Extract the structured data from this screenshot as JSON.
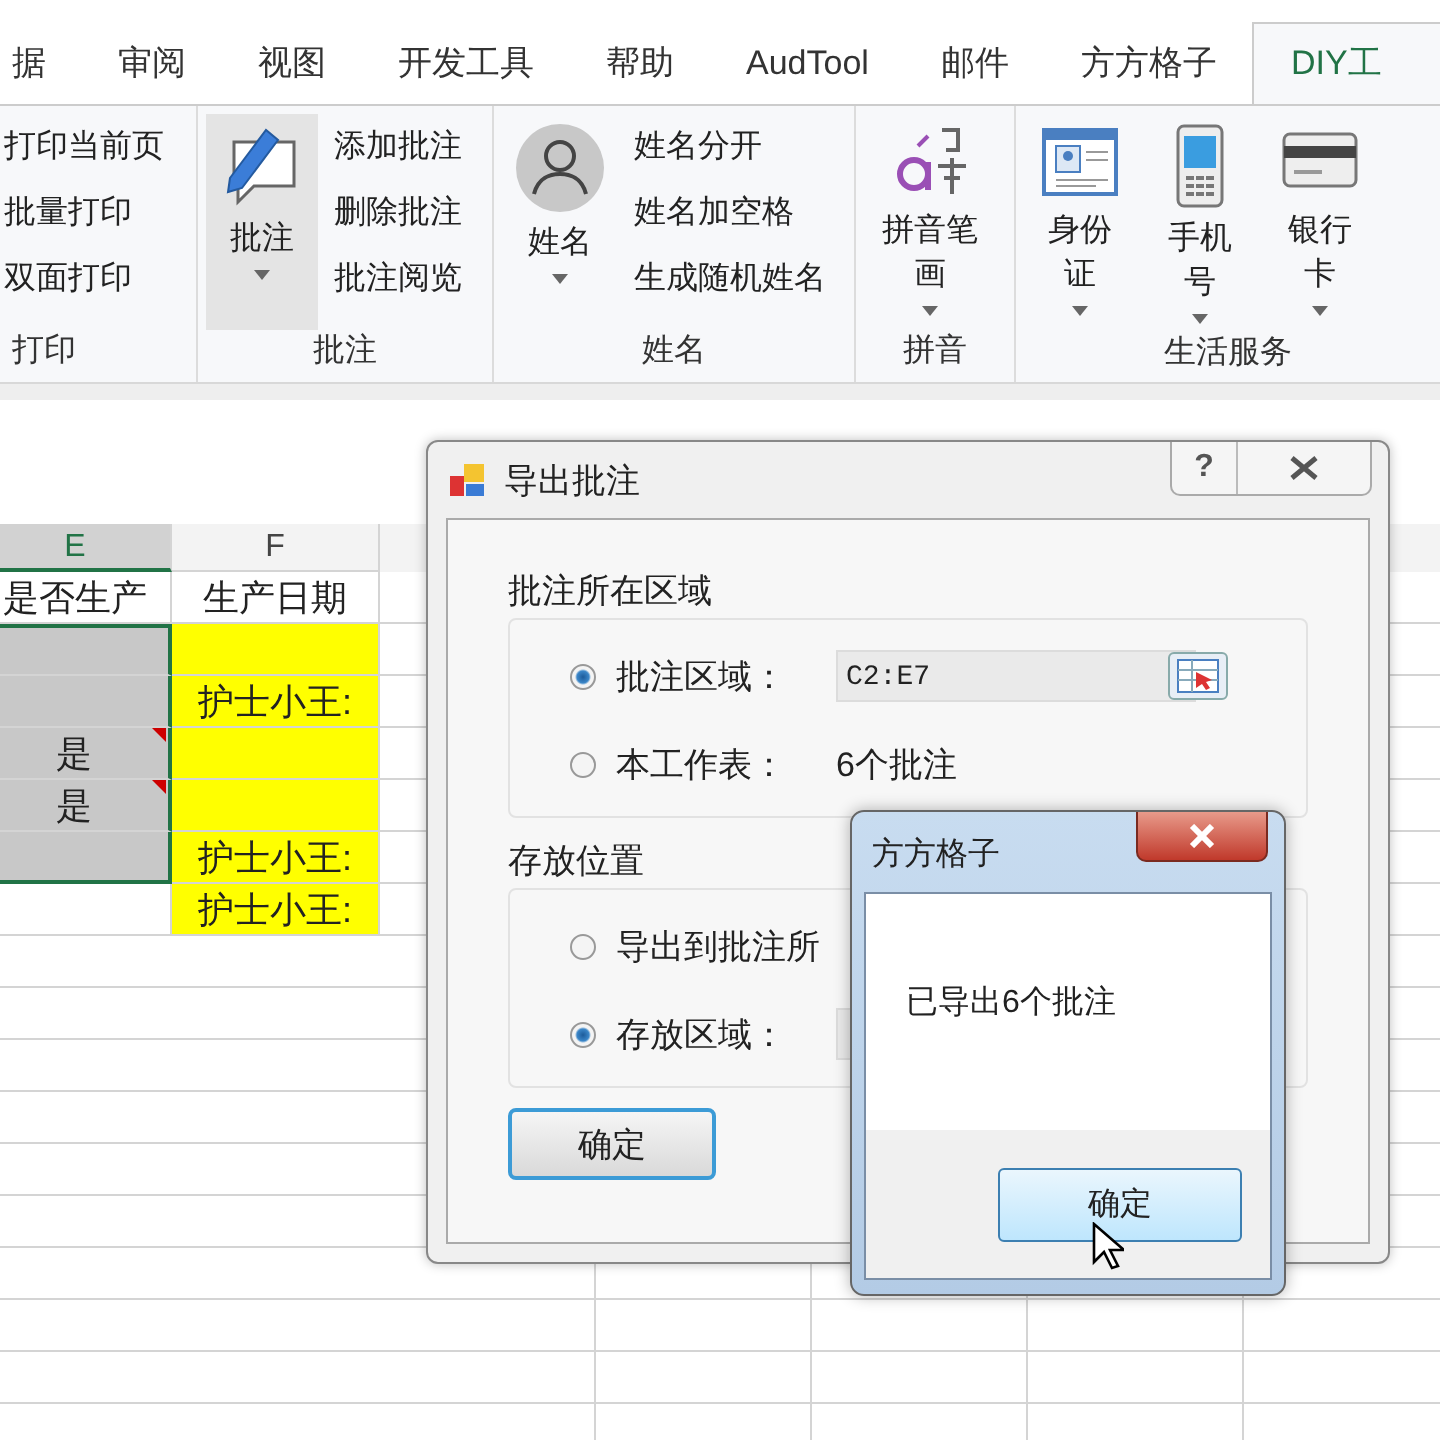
{
  "tabs": [
    {
      "label": "据",
      "selected": false
    },
    {
      "label": "审阅",
      "selected": false
    },
    {
      "label": "视图",
      "selected": false
    },
    {
      "label": "开发工具",
      "selected": false
    },
    {
      "label": "帮助",
      "selected": false
    },
    {
      "label": "AudTool",
      "selected": false
    },
    {
      "label": "邮件",
      "selected": false
    },
    {
      "label": "方方格子",
      "selected": false
    },
    {
      "label": "DIY工",
      "selected": true
    }
  ],
  "ribbon_groups": [
    {
      "label": "打印",
      "small": [
        "打印当前页",
        "批量打印",
        "双面打印"
      ]
    },
    {
      "label": "批注",
      "large": [
        {
          "label": "批注",
          "kind": "comment",
          "dropdown": true,
          "hovered": true
        }
      ],
      "small": [
        "添加批注",
        "删除批注",
        "批注阅览"
      ]
    },
    {
      "label": "姓名",
      "large": [
        {
          "label": "姓名",
          "kind": "person",
          "dropdown": true,
          "hovered": false
        }
      ],
      "small": [
        "姓名分开",
        "姓名加空格",
        "生成随机姓名"
      ]
    },
    {
      "label": "拼音",
      "large": [
        {
          "label": "拼音笔画",
          "kind": "pinyin",
          "dropdown": true,
          "hovered": false
        }
      ]
    },
    {
      "label": "生活服务",
      "large": [
        {
          "label": "身份证",
          "kind": "idcard",
          "dropdown": true,
          "hovered": false
        },
        {
          "label": "手机号",
          "kind": "phone",
          "dropdown": true,
          "hovered": false
        },
        {
          "label": "银行卡",
          "kind": "card",
          "dropdown": true,
          "hovered": false
        }
      ]
    }
  ],
  "sheet": {
    "columns": [
      {
        "label": "E",
        "selected": true
      },
      {
        "label": "F",
        "selected": false
      }
    ],
    "rows": [
      [
        {
          "text": "是否生产",
          "selected": false,
          "comment": false
        },
        {
          "text": "生产日期",
          "selected": false,
          "comment": false
        }
      ],
      [
        {
          "selected": true,
          "comment": false
        },
        {
          "selected": false,
          "comment": false,
          "color": "#ffff00"
        }
      ],
      [
        {
          "selected": true,
          "comment": false
        },
        {
          "text": "护士小王:",
          "selected": false,
          "comment": false,
          "color": "#ffff00"
        }
      ],
      [
        {
          "text": "是",
          "selected": true,
          "comment": true
        },
        {
          "selected": false,
          "comment": false,
          "color": "#ffff00"
        }
      ],
      [
        {
          "text": "是",
          "selected": true,
          "comment": true
        },
        {
          "selected": false,
          "comment": false,
          "color": "#ffff00"
        }
      ],
      [
        {
          "selected": true,
          "comment": false
        },
        {
          "text": "护士小王:",
          "selected": false,
          "comment": false,
          "color": "#ffff00"
        }
      ],
      [
        {
          "selected": false,
          "comment": false
        },
        {
          "text": "护士小王:",
          "selected": false,
          "comment": false,
          "color": "#ffff00"
        }
      ]
    ]
  },
  "export_dialog": {
    "title": "导出批注",
    "help_button": "?",
    "groups": [
      {
        "title": "批注所在区域",
        "options": [
          {
            "kind": "field",
            "label": "批注区域：",
            "selected": true,
            "value": "C2:E7"
          },
          {
            "kind": "info",
            "label": "本工作表：",
            "selected": false,
            "value": "6个批注"
          }
        ]
      },
      {
        "title": "存放位置",
        "options": [
          {
            "kind": "plain",
            "label": "导出到批注所",
            "selected": false
          },
          {
            "kind": "field",
            "label": "存放区域：",
            "selected": true
          }
        ]
      }
    ],
    "ok_button": "确定"
  },
  "message_box": {
    "title": "方方格子",
    "message": "已导出6个批注",
    "ok_button": "确定",
    "ok_hovered": true
  }
}
